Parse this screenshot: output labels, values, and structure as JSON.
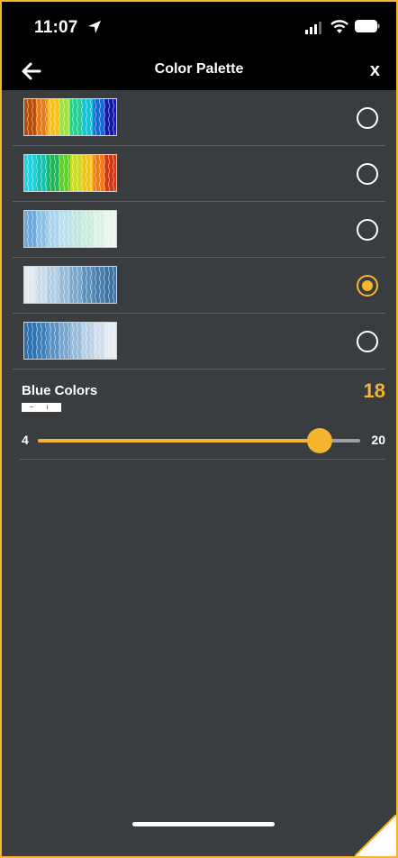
{
  "status": {
    "time": "11:07",
    "location_icon": "location-arrow-icon",
    "signal_icon": "cellular-signal-icon",
    "wifi_icon": "wifi-icon",
    "battery_icon": "battery-icon"
  },
  "nav": {
    "title": "Color Palette",
    "back_icon": "back-arrow-icon",
    "close_label": "x"
  },
  "palettes": [
    {
      "colors": [
        "#b84a06",
        "#e7791a",
        "#f6c21a",
        "#9fe23a",
        "#24d08f",
        "#1ac0d8",
        "#1569d4",
        "#1418a8"
      ],
      "selected": false
    },
    {
      "colors": [
        "#1ed4e0",
        "#16c2b0",
        "#1fb45a",
        "#5dce2a",
        "#cddb20",
        "#f3c21b",
        "#ee7b17",
        "#d2350f"
      ],
      "selected": false
    },
    {
      "colors": [
        "#6aa9d9",
        "#8ac0e4",
        "#a9d4ec",
        "#b9e0ea",
        "#c1e6df",
        "#cdebdc",
        "#dcf1e6",
        "#e9f6f0"
      ],
      "selected": false
    },
    {
      "colors": [
        "#dfe9f1",
        "#c8dbea",
        "#b1cde2",
        "#96bbd8",
        "#7aa7cb",
        "#5e92bd",
        "#4a80b0",
        "#3e72a3"
      ],
      "selected": true
    },
    {
      "colors": [
        "#2b6fae",
        "#3c7fb9",
        "#5a92c4",
        "#78a6cf",
        "#98bbd9",
        "#b7cfe3",
        "#cfdeec",
        "#e4ecf4"
      ],
      "selected": false
    }
  ],
  "setting": {
    "label": "Blue Colors",
    "value": "18",
    "stepper_text": "− ı +",
    "min": "4",
    "max": "20",
    "slider_fraction": 0.875
  },
  "colors": {
    "accent": "#f5b52e",
    "background": "#3a3d40",
    "bar": "#000000"
  }
}
